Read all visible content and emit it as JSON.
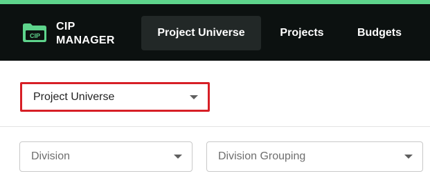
{
  "header": {
    "logo": {
      "icon_name": "cip-folder-icon",
      "icon_text": "CIP",
      "line1": "CIP",
      "line2": "MANAGER"
    },
    "tabs": [
      {
        "label": "Project Universe",
        "active": true
      },
      {
        "label": "Projects",
        "active": false
      },
      {
        "label": "Budgets",
        "active": false
      }
    ]
  },
  "universe_select": {
    "value": "Project Universe",
    "icon_name": "caret-down-icon"
  },
  "filters": {
    "division": {
      "placeholder": "Division"
    },
    "division_grouping": {
      "placeholder": "Division Grouping"
    }
  },
  "colors": {
    "accent": "#5ed48c",
    "navbar_bg": "#0c1110",
    "active_tab_bg": "#222827",
    "highlight_border": "#d71f26"
  }
}
